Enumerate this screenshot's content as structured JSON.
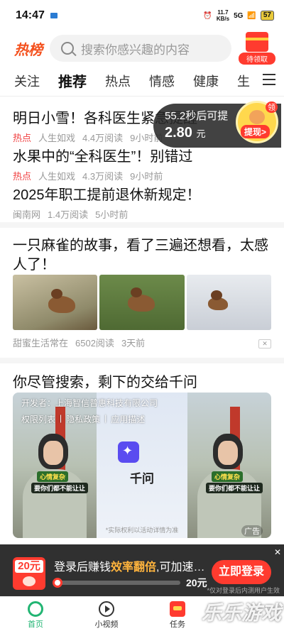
{
  "status_bar": {
    "time": "14:47",
    "net_speed": "11.7",
    "net_unit": "KB/s",
    "signal": "5G",
    "battery": "57"
  },
  "header": {
    "logo": "热榜",
    "search_placeholder": "搜索你感兴趣的内容",
    "gift_label": "待领取"
  },
  "tabs": [
    "关注",
    "推荐",
    "热点",
    "情感",
    "健康",
    "生"
  ],
  "active_tab": "推荐",
  "reward": {
    "countdown": "55.2秒后可提",
    "amount": "2.80",
    "unit": "元",
    "badge": "领",
    "cashout": "提现>"
  },
  "feed": [
    {
      "title": "明日小雪！各科医生紧急提醒",
      "hot": "热点",
      "source": "人生如戏",
      "reads": "4.4万阅读",
      "time": "9小时前"
    },
    {
      "title": "水果中的“全科医生”！别错过",
      "hot": "热点",
      "source": "人生如戏",
      "reads": "4.3万阅读",
      "time": "9小时前"
    },
    {
      "title": "2025年职工提前退休新规定！",
      "hot": "",
      "source": "闽南网",
      "reads": "1.4万阅读",
      "time": "5小时前"
    }
  ],
  "article": {
    "title": "一只麻雀的故事，看了三遍还想看，太感人了！",
    "source": "甜蜜生活常在",
    "reads": "6502阅读",
    "time": "3天前"
  },
  "ad": {
    "title": "你尽管搜索，剩下的交给千问",
    "developer": "开发者：上海智信普惠科技有限公司",
    "links": [
      "权限列表",
      "隐私政策",
      "应用描述"
    ],
    "tag1": "心情复杂",
    "tag2": "要你们都不能让让",
    "app_name": "千问",
    "note": "*实际权利以活动详情为准",
    "ad_label": "广告"
  },
  "promo": {
    "coupon": "20元",
    "text_prefix": "登录后赚钱",
    "text_highlight": "效率翻倍",
    "text_suffix": ",可加速…",
    "progress_amount": "20元",
    "progress": 0.04,
    "button": "立即登录",
    "note": "*仅对登录后内测用户生效"
  },
  "bottom_nav": [
    "首页",
    "小视频",
    "任务"
  ],
  "watermark": "乐乐游戏"
}
